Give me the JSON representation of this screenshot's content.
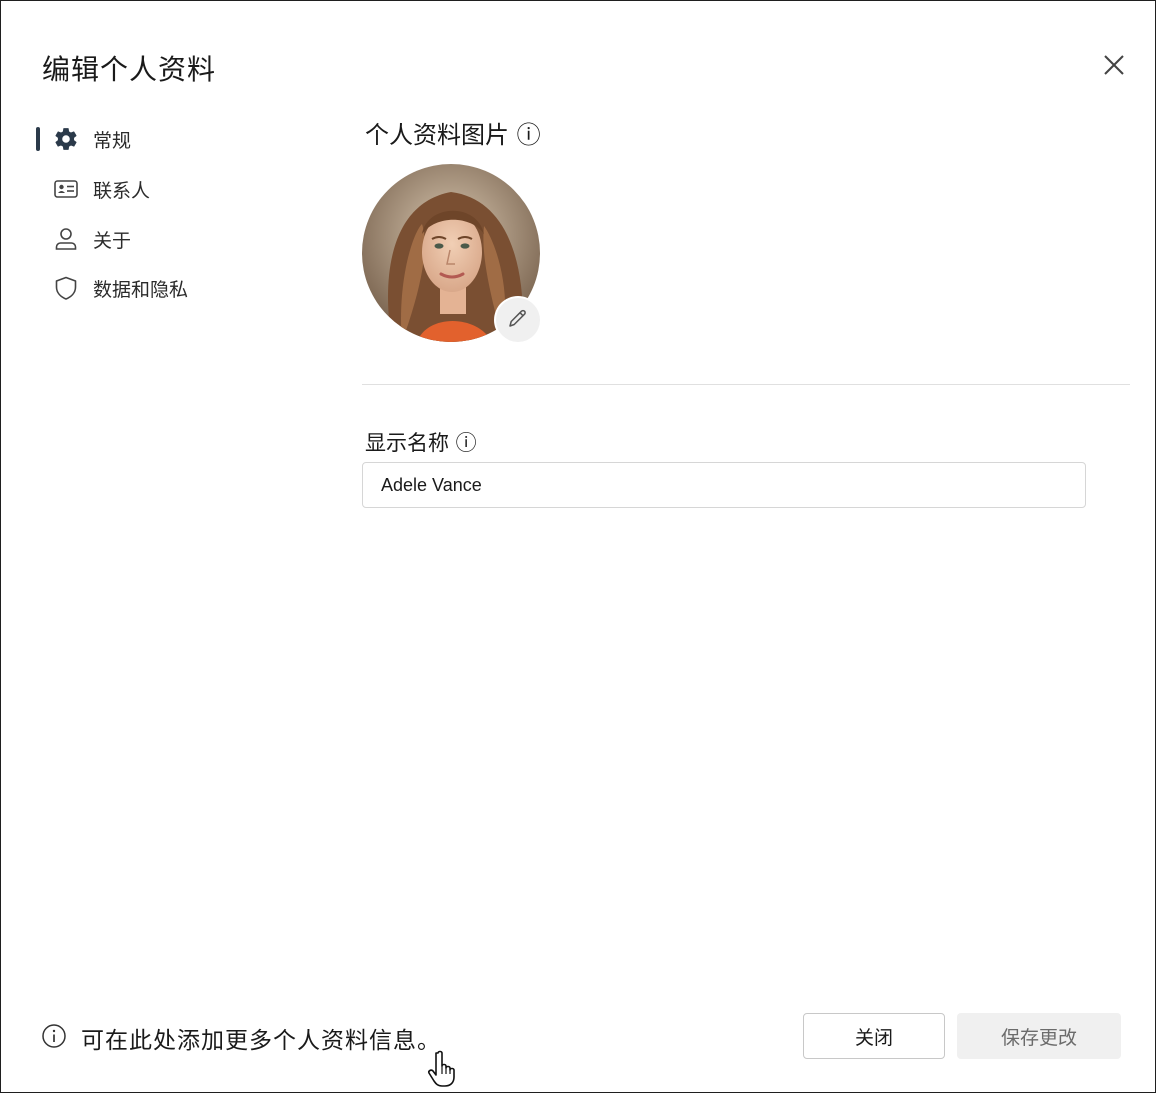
{
  "dialog": {
    "title": "编辑个人资料",
    "close_icon": "close-icon"
  },
  "nav": {
    "items": [
      {
        "label": "常规",
        "icon": "gear-icon",
        "selected": true
      },
      {
        "label": "联系人",
        "icon": "contact-card-icon",
        "selected": false
      },
      {
        "label": "关于",
        "icon": "person-icon",
        "selected": false
      },
      {
        "label": "数据和隐私",
        "icon": "shield-icon",
        "selected": false
      }
    ]
  },
  "profile_picture": {
    "title": "个人资料图片 ⓘ",
    "edit_icon": "pencil-icon"
  },
  "display_name": {
    "label": "显示名称 ⓘ",
    "value": "Adele Vance"
  },
  "footer": {
    "info_text": "可在此处添加更多个人资料信息。",
    "close_label": "关闭",
    "save_label": "保存更改"
  },
  "colors": {
    "indicator": "#2b3a4a",
    "save_bg": "#f0f0f0",
    "border": "#1f1f1f"
  }
}
